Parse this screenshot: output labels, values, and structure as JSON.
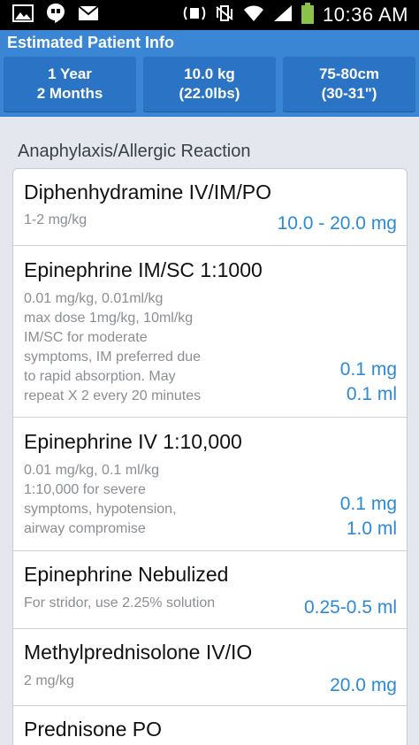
{
  "status_bar": {
    "time": "10:36 AM",
    "icons": [
      "image-icon",
      "hangouts-icon",
      "mail-icon",
      "nfc-icon",
      "vibrate-icon",
      "wifi-icon",
      "signal-icon",
      "battery-icon"
    ]
  },
  "header": {
    "title": "Estimated Patient Info",
    "age": {
      "line1": "1 Year",
      "line2": "2 Months"
    },
    "weight": {
      "line1": "10.0 kg",
      "line2": "(22.0lbs)"
    },
    "height": {
      "line1": "75-80cm",
      "line2": "(30-31\")"
    },
    "background_color": "#3a86d4",
    "button_color": "#2b73c4"
  },
  "section": {
    "title": "Anaphylaxis/Allergic Reaction"
  },
  "drugs": [
    {
      "name": "Diphenhydramine IV/IM/PO",
      "notes": [
        "1-2 mg/kg"
      ],
      "doses": [
        "10.0 - 20.0 mg"
      ]
    },
    {
      "name": "Epinephrine IM/SC 1:1000",
      "notes": [
        "0.01 mg/kg, 0.01ml/kg",
        "max dose 1mg/kg, 10ml/kg",
        "IM/SC for moderate",
        "symptoms, IM preferred due",
        "to rapid absorption. May",
        "repeat X 2 every 20 minutes"
      ],
      "doses": [
        "0.1 mg",
        "0.1 ml"
      ]
    },
    {
      "name": "Epinephrine IV 1:10,000",
      "notes": [
        "0.01 mg/kg, 0.1 ml/kg",
        "1:10,000 for severe",
        "symptoms, hypotension,",
        "airway compromise"
      ],
      "doses": [
        "0.1 mg",
        "1.0 ml"
      ]
    },
    {
      "name": "Epinephrine Nebulized",
      "notes": [
        "For stridor, use 2.25% solution"
      ],
      "doses": [
        "0.25-0.5 ml"
      ]
    },
    {
      "name": "Methylprednisolone IV/IO",
      "notes": [
        "2 mg/kg"
      ],
      "doses": [
        "20.0 mg"
      ]
    },
    {
      "name": "Prednisone PO",
      "notes": [],
      "doses": []
    }
  ],
  "colors": {
    "dose": "#2b8ad8",
    "note": "#8a8e93",
    "background": "#e4e8ee"
  }
}
